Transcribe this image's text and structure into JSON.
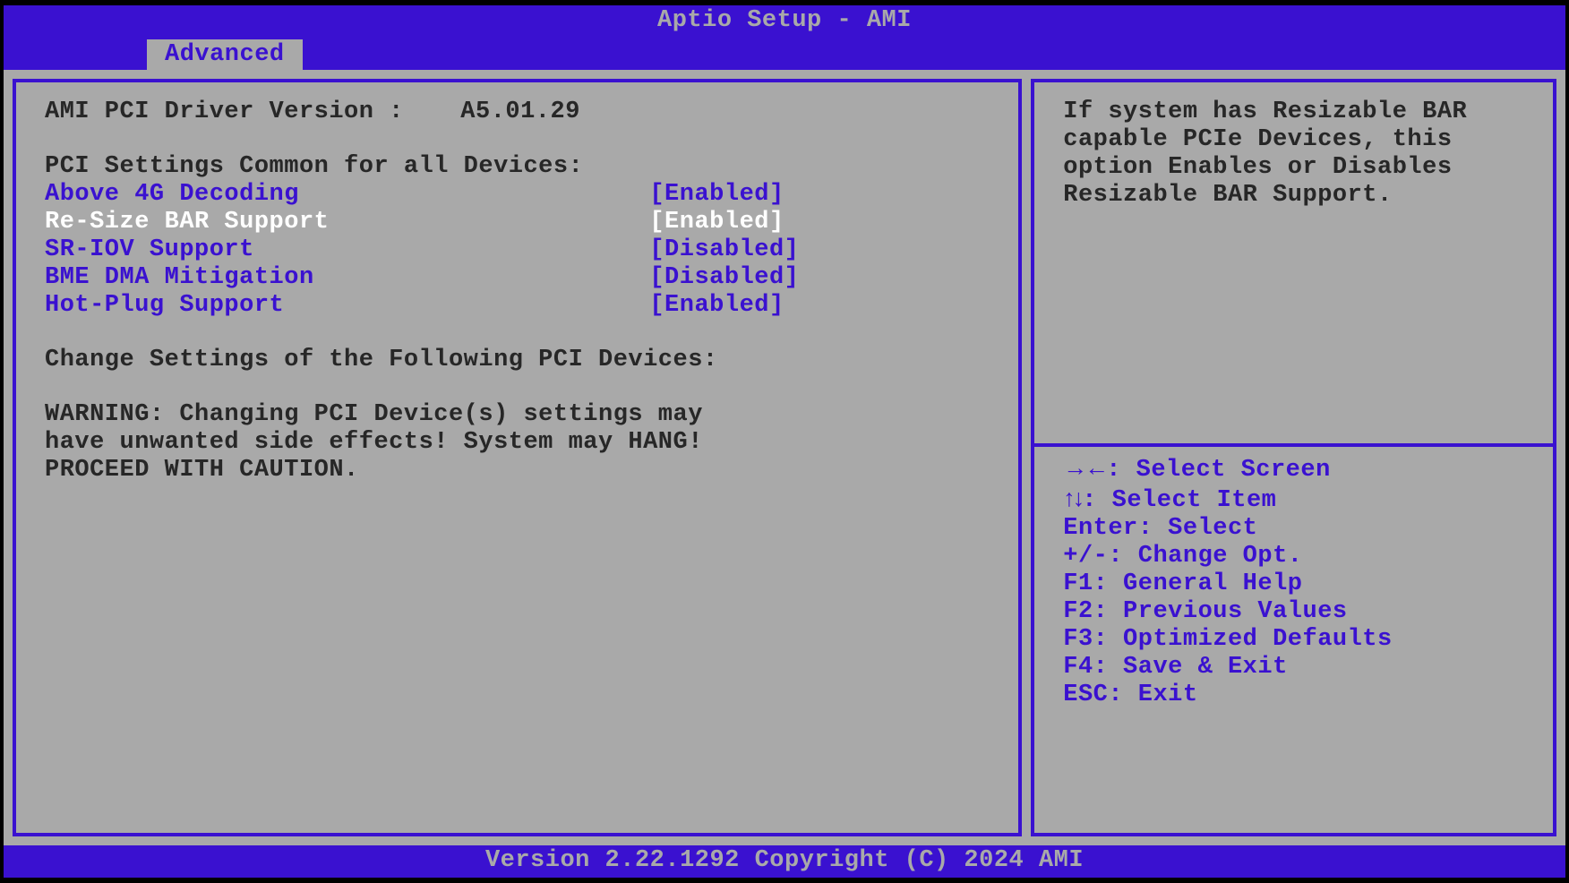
{
  "header": {
    "title": "Aptio Setup - AMI"
  },
  "tabs": {
    "active": "Advanced"
  },
  "info": {
    "driver_label": "AMI PCI Driver Version :",
    "driver_value": "A5.01.29",
    "section1": "PCI Settings Common for all Devices:",
    "section2": "Change Settings of the Following PCI Devices:",
    "warn1": "WARNING: Changing PCI Device(s) settings may",
    "warn2": "have unwanted side effects! System may HANG!",
    "warn3": "PROCEED WITH CAUTION."
  },
  "settings": [
    {
      "name": "Above 4G Decoding",
      "value": "[Enabled]",
      "selected": false
    },
    {
      "name": "Re-Size BAR Support",
      "value": "[Enabled]",
      "selected": true
    },
    {
      "name": "SR-IOV Support",
      "value": "[Disabled]",
      "selected": false
    },
    {
      "name": "BME DMA Mitigation",
      "value": "[Disabled]",
      "selected": false
    },
    {
      "name": "Hot-Plug Support",
      "value": "[Enabled]",
      "selected": false
    }
  ],
  "help": {
    "text": "If system has Resizable BAR capable PCIe Devices, this option Enables or Disables Resizable BAR Support."
  },
  "nav": {
    "k0a": "→←",
    "k0b": ": Select Screen",
    "k1a": "↑↓",
    "k1b": ": Select Item",
    "k2": "Enter: Select",
    "k3": "+/-: Change Opt.",
    "k4": "F1: General Help",
    "k5": "F2: Previous Values",
    "k6": "F3: Optimized Defaults",
    "k7": "F4: Save & Exit",
    "k8": "ESC: Exit"
  },
  "footer": {
    "text": "Version 2.22.1292 Copyright (C) 2024 AMI"
  }
}
